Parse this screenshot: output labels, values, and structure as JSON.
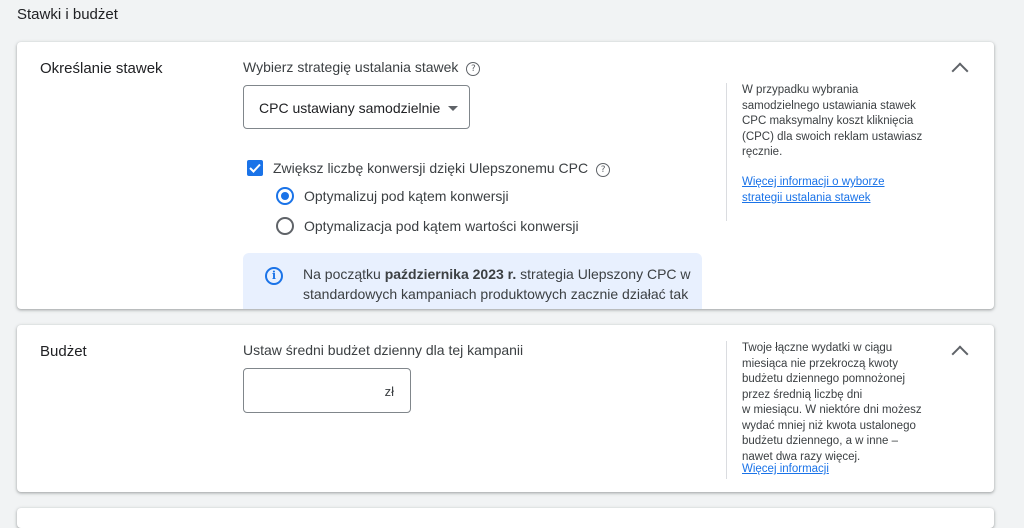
{
  "section_title": "Stawki i budżet",
  "bidding": {
    "title": "Określanie stawek",
    "strategy_label": "Wybierz strategię ustalania stawek",
    "help_icon": "help-circle-icon",
    "dropdown_value": "CPC ustawiany samodzielnie",
    "checkbox_label": "Zwiększ liczbę konwersji dzięki Ulepszonemu CPC",
    "checkbox_checked": true,
    "radio_options": [
      {
        "label": "Optymalizuj pod kątem konwersji",
        "selected": true
      },
      {
        "label": "Optymalizacja pod kątem wartości konwersji",
        "selected": false
      }
    ],
    "info": {
      "icon": "info-icon",
      "text_before": "Na początku ",
      "text_bold": "października 2023 r.",
      "text_after": " strategia Ulepszony CPC w standardowych kampaniach produktowych zacznie działać tak samo jak samodzielnie ustawiany Ulepszony CPC."
    },
    "side_text": "W przypadku wybrania\nsamodzielnego ustawiania stawek\nCPC maksymalny koszt kliknięcia\n(CPC) dla swoich reklam ustawiasz\nręcznie.",
    "side_link": "Więcej informacji o wyborze\nstrategii ustalania stawek",
    "collapse_icon": "chevron-up-icon"
  },
  "budget": {
    "title": "Budżet",
    "label": "Ustaw średni budżet dzienny dla tej kampanii",
    "input_value": "",
    "currency": "zł",
    "side_text": "Twoje łączne wydatki w ciągu\nmiesiąca nie przekroczą kwoty\nbudżetu dziennego pomnożonej\nprzez średnią liczbę dni\nw miesiącu. W niektóre dni możesz\nwydać mniej niż kwota ustalonego\nbudżetu dziennego, a w inne –\nnawet dwa razy więcej.",
    "side_link": "Więcej informacji",
    "collapse_icon": "chevron-up-icon"
  }
}
